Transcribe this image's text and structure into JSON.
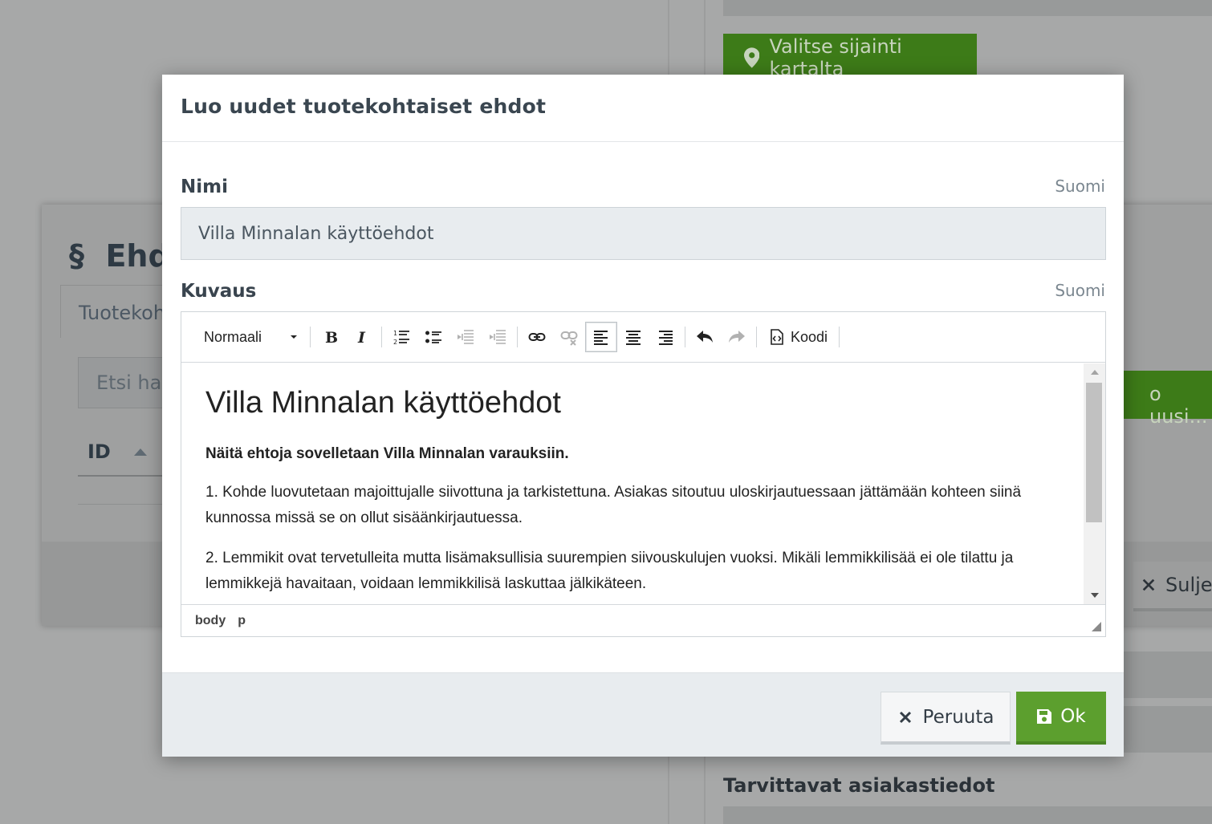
{
  "background": {
    "map_button_label": "Valitse sijainti kartalta",
    "section_heading": "Tarvittavat asiakastiedot",
    "dialog": {
      "title": "Ehd",
      "section_symbol": "§",
      "tab_label": "Tuotekoht",
      "search_placeholder": "Etsi hak",
      "column_id": "ID",
      "new_button_label": "o uusi...",
      "close_button_label": "Sulje"
    }
  },
  "modal": {
    "title": "Luo uudet tuotekohtaiset ehdot",
    "name_field": {
      "label": "Nimi",
      "language": "Suomi",
      "value": "Villa Minnalan käyttöehdot"
    },
    "description_field": {
      "label": "Kuvaus",
      "language": "Suomi"
    },
    "editor": {
      "format_select": "Normaali",
      "code_button_label": "Koodi",
      "content": {
        "heading": "Villa Minnalan käyttöehdot",
        "lead": "Näitä ehtoja sovelletaan Villa Minnalan varauksiin.",
        "paragraphs": [
          "1. Kohde luovutetaan majoittujalle siivottuna ja tarkistettuna. Asiakas sitoutuu uloskirjautuessaan jättämään kohteen siinä kunnossa missä se on ollut sisäänkirjautuessa.",
          "2. Lemmikit ovat tervetulleita mutta lisämaksullisia suurempien siivouskulujen vuoksi. Mikäli lemmikkilisää ei ole tilattu ja lemmikkejä havaitaan, voidaan lemmikkilisä laskuttaa jälkikäteen."
        ]
      },
      "path": [
        "body",
        "p"
      ]
    },
    "buttons": {
      "cancel_label": "Peruuta",
      "ok_label": "Ok"
    }
  },
  "colors": {
    "primary_green": "#5c9f2e",
    "overlay_gray": "#a7a8a8"
  }
}
